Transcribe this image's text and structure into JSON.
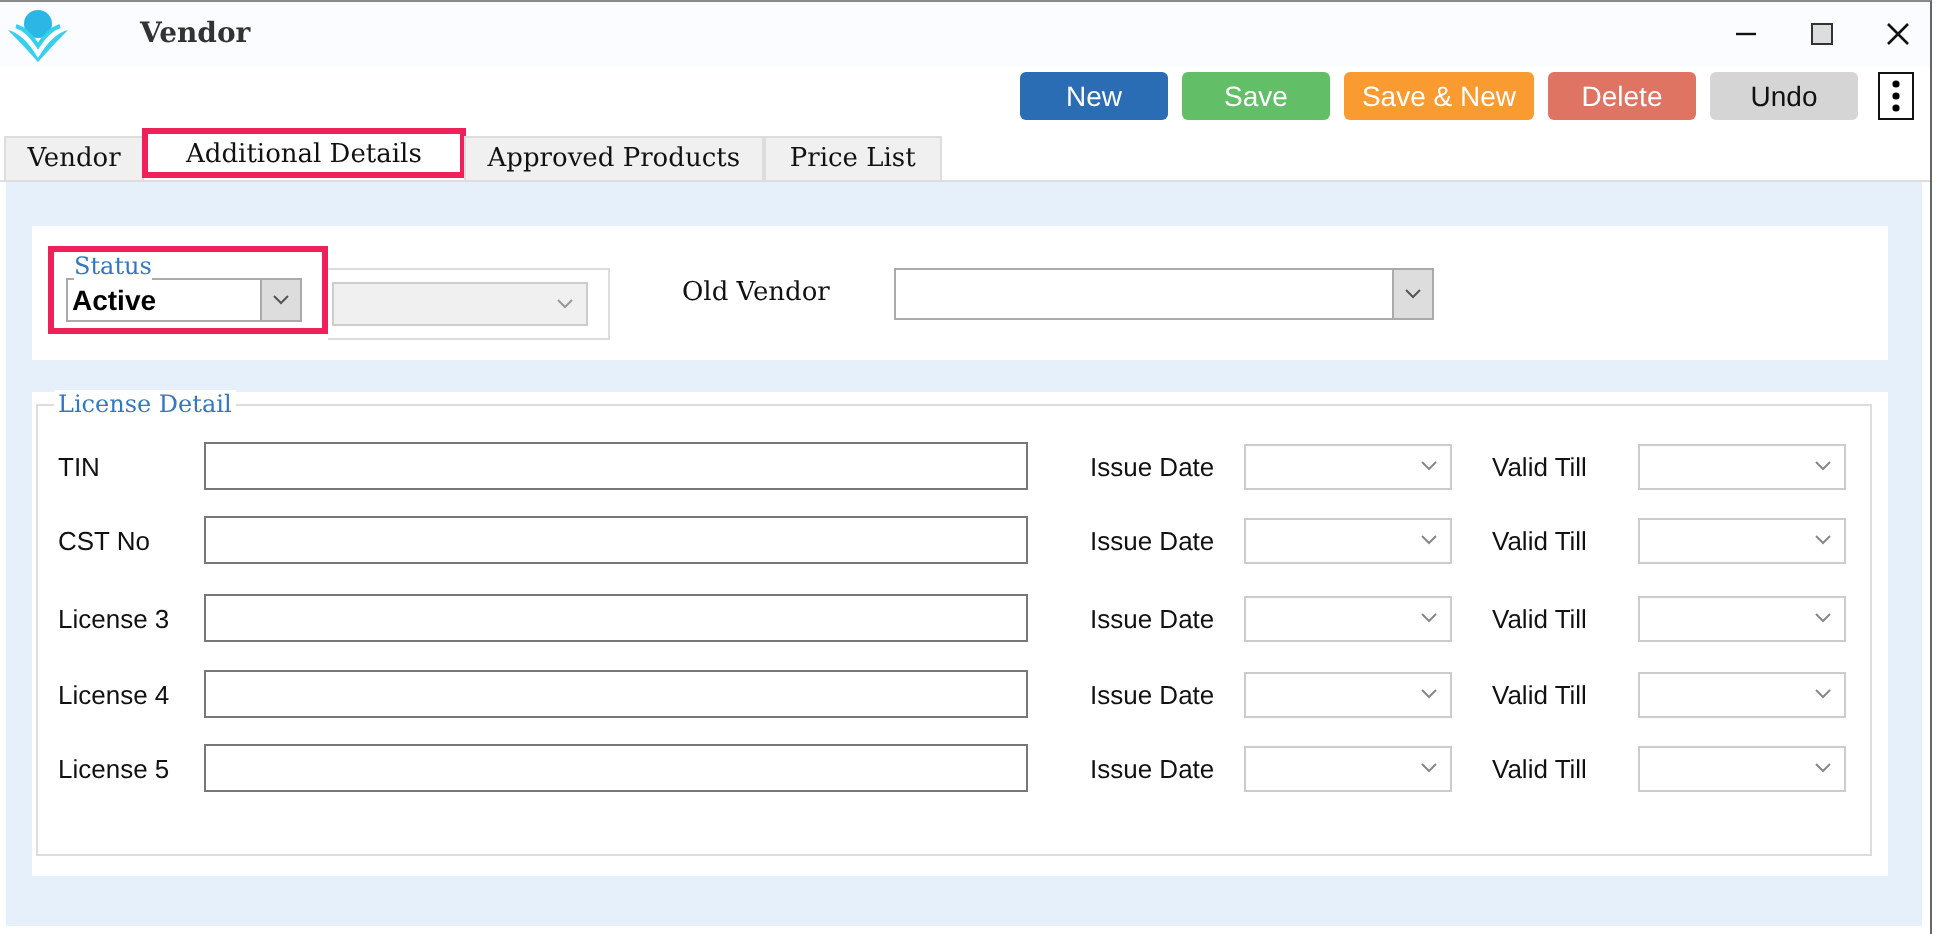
{
  "window": {
    "title": "Vendor"
  },
  "toolbar": [
    {
      "label": "New",
      "kind": "primary"
    },
    {
      "label": "Save",
      "kind": "success"
    },
    {
      "label": "Save & New",
      "kind": "warning"
    },
    {
      "label": "Delete",
      "kind": "danger"
    },
    {
      "label": "Undo",
      "kind": "neutral"
    }
  ],
  "tabs": [
    {
      "label": "Vendor",
      "selected": false,
      "highlighted": false
    },
    {
      "label": "Additional Details",
      "selected": true,
      "highlighted": true
    },
    {
      "label": "Approved Products",
      "selected": false,
      "highlighted": false
    },
    {
      "label": "Price List",
      "selected": false,
      "highlighted": false
    }
  ],
  "status": {
    "legend": "Status",
    "value": "Active",
    "highlighted": true,
    "secondary_disabled": true
  },
  "old_vendor": {
    "label": "Old Vendor"
  },
  "license_detail": {
    "legend": "License Detail",
    "rows": [
      {
        "label": "TIN",
        "issue_label": "Issue Date",
        "valid_label": "Valid Till"
      },
      {
        "label": "CST No",
        "issue_label": "Issue Date",
        "valid_label": "Valid Till"
      },
      {
        "label": "License 3",
        "issue_label": "Issue Date",
        "valid_label": "Valid Till"
      },
      {
        "label": "License 4",
        "issue_label": "Issue Date",
        "valid_label": "Valid Till"
      },
      {
        "label": "License 5",
        "issue_label": "Issue Date",
        "valid_label": "Valid Till"
      }
    ]
  }
}
